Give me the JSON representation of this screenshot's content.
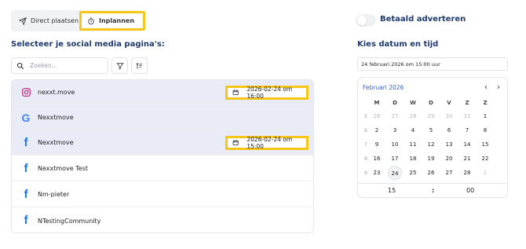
{
  "mode": {
    "direct_label": "Direct plaatsen",
    "schedule_label": "Inplannen"
  },
  "paid": {
    "label": "Betaald adverteren",
    "enabled": false
  },
  "pages_section": {
    "title": "Selecteer je social media pagina's:",
    "search_placeholder": "Zoeken...",
    "filter_icon": "filter-icon",
    "sort_icon": "sort-icon"
  },
  "pages": [
    {
      "name": "nexxt.move",
      "platform": "instagram",
      "selected": true,
      "schedule": "2026-02-24 om 16:00"
    },
    {
      "name": "Nexxtmove",
      "platform": "google",
      "selected": true,
      "schedule": ""
    },
    {
      "name": "Nexxtmove",
      "platform": "facebook",
      "selected": true,
      "schedule": "2026-02-24 om 15:00"
    },
    {
      "name": "Nexxtmove Test",
      "platform": "facebook",
      "selected": false,
      "schedule": ""
    },
    {
      "name": "Nm-pieter",
      "platform": "facebook",
      "selected": false,
      "schedule": ""
    },
    {
      "name": "NTestingCommunity",
      "platform": "facebook",
      "selected": false,
      "schedule": ""
    }
  ],
  "datetime": {
    "title": "Kies datum en tijd",
    "value": "24 februari 2026 om 15:00 uur"
  },
  "calendar": {
    "month": "Februari 2026",
    "prev_icon": "chevron-left-icon",
    "next_icon": "chevron-right-icon",
    "weekdays": [
      "M",
      "D",
      "W",
      "D",
      "V",
      "Z",
      "Z"
    ],
    "weeks": [
      {
        "wk": "5",
        "days": [
          "26",
          "27",
          "28",
          "29",
          "30",
          "31",
          "1"
        ],
        "muted": [
          true,
          true,
          true,
          true,
          true,
          true,
          false
        ]
      },
      {
        "wk": "6",
        "days": [
          "2",
          "3",
          "4",
          "5",
          "6",
          "7",
          "8"
        ],
        "muted": [
          false,
          false,
          false,
          false,
          false,
          false,
          false
        ]
      },
      {
        "wk": "7",
        "days": [
          "9",
          "10",
          "11",
          "12",
          "13",
          "14",
          "15"
        ],
        "muted": [
          false,
          false,
          false,
          false,
          false,
          false,
          false
        ]
      },
      {
        "wk": "8",
        "days": [
          "16",
          "17",
          "18",
          "19",
          "20",
          "21",
          "22"
        ],
        "muted": [
          false,
          false,
          false,
          false,
          false,
          false,
          false
        ]
      },
      {
        "wk": "9",
        "days": [
          "23",
          "24",
          "25",
          "26",
          "27",
          "28",
          "1"
        ],
        "muted": [
          false,
          false,
          false,
          false,
          false,
          false,
          true
        ]
      }
    ],
    "selected_day": "24",
    "hour": "15",
    "separator": ":",
    "minute": "00"
  },
  "colors": {
    "highlight": "#f5c518",
    "heading": "#1f3a6e",
    "selected_row": "#e9ecf7",
    "facebook": "#1877f2"
  }
}
